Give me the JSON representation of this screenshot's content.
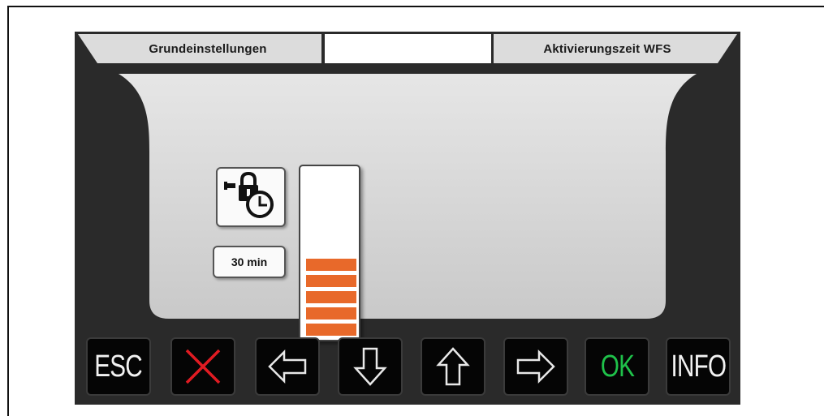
{
  "header": {
    "left_title": "Grundeinstellungen",
    "middle_title": "",
    "right_title": "Aktivierungszeit WFS"
  },
  "setting": {
    "icon": "lock-clock-icon",
    "value_label": "30 min",
    "level_segments_filled": 5
  },
  "buttons": [
    {
      "id": "esc",
      "label": "ESC",
      "icon": null
    },
    {
      "id": "cancel",
      "label": "",
      "icon": "red-x-icon"
    },
    {
      "id": "left",
      "label": "",
      "icon": "arrow-left-icon"
    },
    {
      "id": "down",
      "label": "",
      "icon": "arrow-down-icon"
    },
    {
      "id": "up",
      "label": "",
      "icon": "arrow-up-icon"
    },
    {
      "id": "right",
      "label": "",
      "icon": "arrow-right-icon"
    },
    {
      "id": "ok",
      "label": "OK",
      "icon": null
    },
    {
      "id": "info",
      "label": "INFO",
      "icon": null
    }
  ],
  "colors": {
    "accent_orange": "#e8692a",
    "ok_green": "#1fc24a",
    "cancel_red": "#e11b22",
    "device_bg": "#2a2a2a"
  }
}
